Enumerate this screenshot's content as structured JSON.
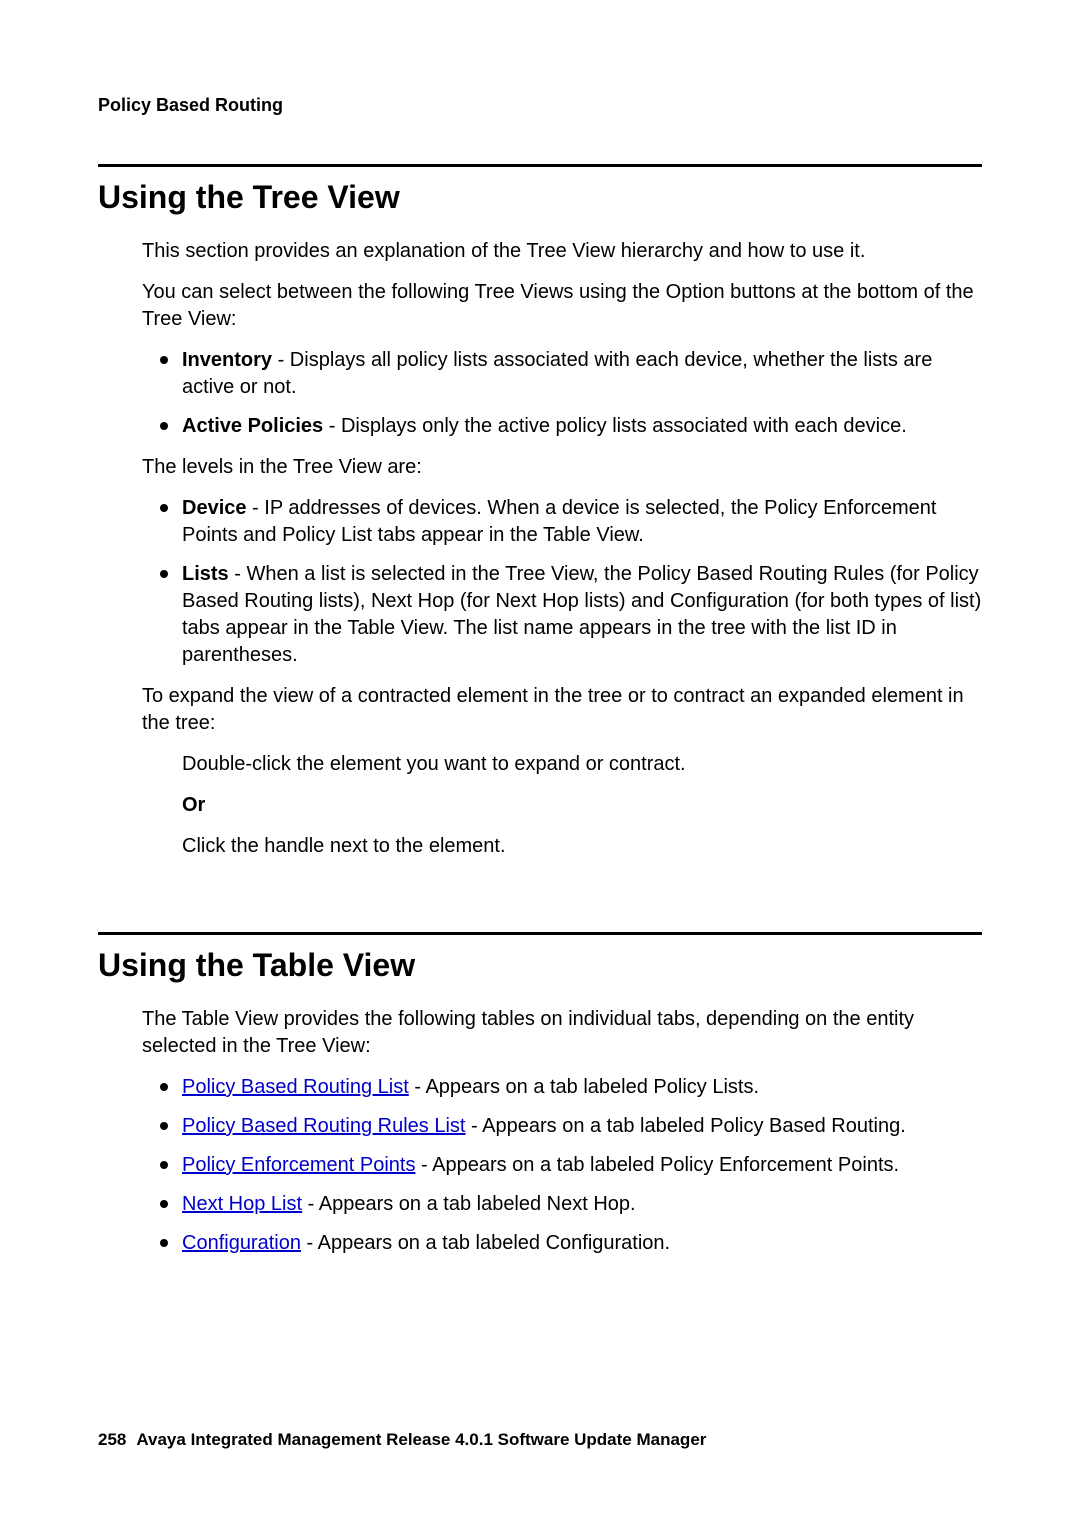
{
  "runningHead": "Policy Based Routing",
  "section1": {
    "title": "Using the Tree View",
    "p1": "This section provides an explanation of the Tree View hierarchy and how to use it.",
    "p2": "You can select between the following Tree Views using the Option buttons at the bottom of the Tree View:",
    "views": [
      {
        "term": "Inventory",
        "desc": " - Displays all policy lists associated with each device, whether the lists are active or not."
      },
      {
        "term": "Active Policies",
        "desc": " - Displays only the active policy lists associated with each device."
      }
    ],
    "p3": "The levels in the Tree View are:",
    "levels": [
      {
        "term": "Device",
        "desc": " - IP addresses of devices. When a device is selected, the Policy Enforcement Points and Policy List tabs appear in the Table View."
      },
      {
        "term": "Lists",
        "desc": " - When a list is selected in the Tree View, the Policy Based Routing Rules (for Policy Based Routing lists), Next Hop (for Next Hop lists) and Configuration (for both types of list) tabs appear in the Table View. The list name appears in the tree with the list ID in parentheses."
      }
    ],
    "p4": "To expand the view of a contracted element in the tree or to contract an expanded element in the tree:",
    "step1": "Double-click the element you want to expand or contract.",
    "or": "Or",
    "step2": "Click the handle next to the element."
  },
  "section2": {
    "title": "Using the Table View",
    "p1": "The Table View provides the following tables on individual tabs, depending on the entity selected in the Tree View:",
    "items": [
      {
        "link": "Policy Based Routing List",
        "rest": " - Appears on a tab labeled Policy Lists."
      },
      {
        "link": "Policy Based Routing Rules List",
        "rest": " - Appears on a tab labeled Policy Based Routing."
      },
      {
        "link": "Policy Enforcement Points",
        "rest": " - Appears on a tab labeled Policy Enforcement Points."
      },
      {
        "link": "Next Hop List",
        "rest": " - Appears on a tab labeled Next Hop."
      },
      {
        "link": "Configuration",
        "rest": " - Appears on a tab labeled Configuration."
      }
    ]
  },
  "footer": {
    "page": "258",
    "text": "Avaya Integrated Management Release 4.0.1 Software Update Manager"
  }
}
